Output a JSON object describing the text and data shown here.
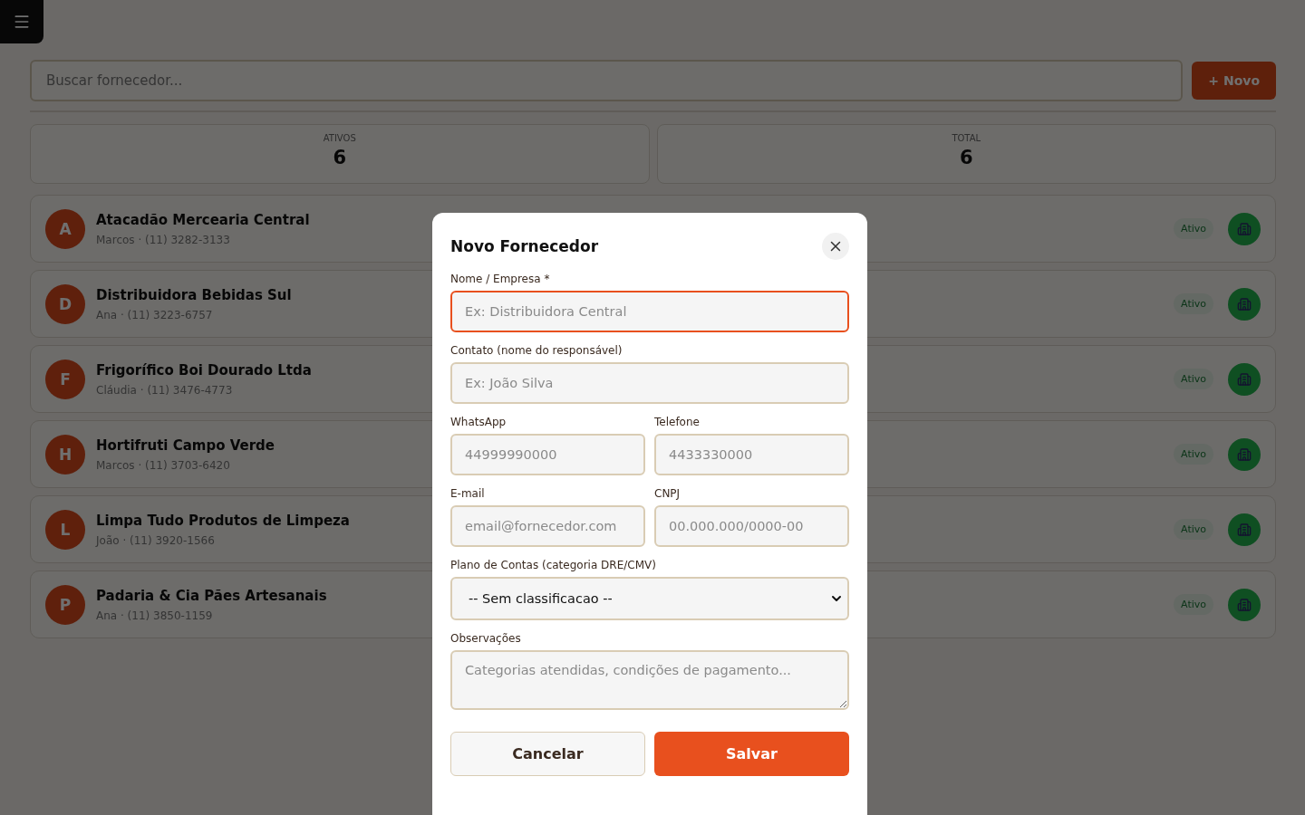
{
  "search": {
    "placeholder": "Buscar fornecedor..."
  },
  "new_button": "+ Novo",
  "stats": [
    {
      "label": "ATIVOS",
      "value": "6"
    },
    {
      "label": "TOTAL",
      "value": "6"
    }
  ],
  "suppliers": [
    {
      "initial": "A",
      "name": "Atacadão Mercearia Central",
      "contact": "Marcos · (11) 3282-3133",
      "status": "Ativo"
    },
    {
      "initial": "D",
      "name": "Distribuidora Bebidas Sul",
      "contact": "Ana · (11) 3223-6757",
      "status": "Ativo"
    },
    {
      "initial": "F",
      "name": "Frigorífico Boi Dourado Ltda",
      "contact": "Cláudia · (11) 3476-4773",
      "status": "Ativo"
    },
    {
      "initial": "H",
      "name": "Hortifruti Campo Verde",
      "contact": "Marcos · (11) 3703-6420",
      "status": "Ativo"
    },
    {
      "initial": "L",
      "name": "Limpa Tudo Produtos de Limpeza",
      "contact": "João · (11) 3920-1566",
      "status": "Ativo"
    },
    {
      "initial": "P",
      "name": "Padaria & Cia Pães Artesanais",
      "contact": "Ana · (11) 3850-1159",
      "status": "Ativo"
    }
  ],
  "modal": {
    "title": "Novo Fornecedor",
    "rows": [
      [
        {
          "kind": "text",
          "label": "Nome / Empresa *",
          "placeholder": "Ex: Distribuidora Central",
          "focused": true
        }
      ],
      [
        {
          "kind": "text",
          "label": "Contato (nome do responsável)",
          "placeholder": "Ex: João Silva",
          "focused": false
        }
      ],
      [
        {
          "kind": "text",
          "label": "WhatsApp",
          "placeholder": "44999990000",
          "focused": false
        },
        {
          "kind": "text",
          "label": "Telefone",
          "placeholder": "4433330000",
          "focused": false
        }
      ],
      [
        {
          "kind": "text",
          "label": "E-mail",
          "placeholder": "email@fornecedor.com",
          "focused": false
        },
        {
          "kind": "text",
          "label": "CNPJ",
          "placeholder": "00.000.000/0000-00",
          "focused": false
        }
      ],
      [
        {
          "kind": "select",
          "label": "Plano de Contas (categoria DRE/CMV)",
          "value": "-- Sem classificacao --",
          "focused": false
        }
      ],
      [
        {
          "kind": "textarea",
          "label": "Observações",
          "placeholder": "Categorias atendidas, condições de pagamento...",
          "focused": false
        }
      ]
    ],
    "cancel": "Cancelar",
    "save": "Salvar"
  }
}
